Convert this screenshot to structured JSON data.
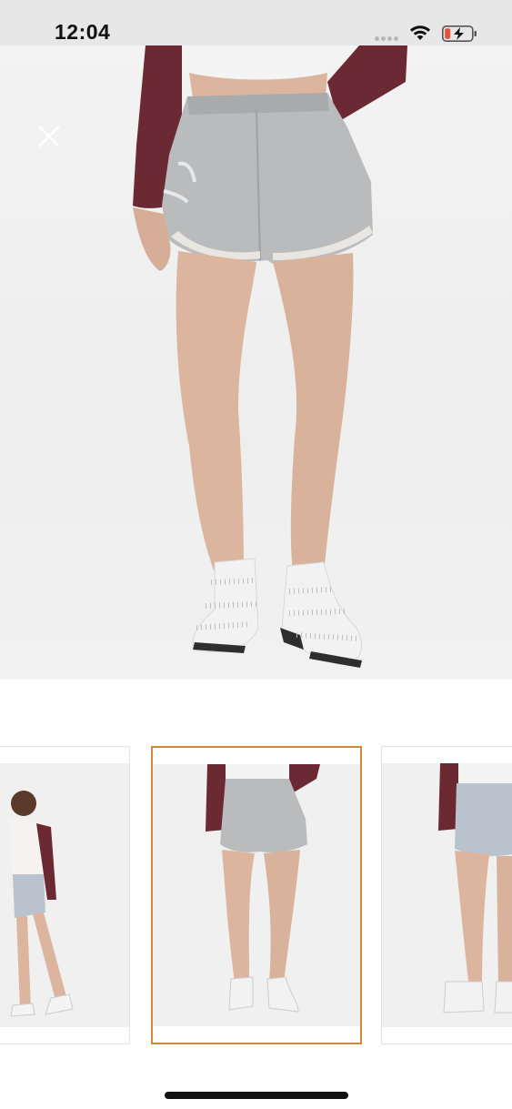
{
  "status_bar": {
    "time": "12:04",
    "icons": [
      "signal-dots-icon",
      "wifi-icon",
      "battery-charging-icon"
    ],
    "battery_color": "#e5533d"
  },
  "hero_image": {
    "alt": "denim-shorts-model-front",
    "close_icon": "close-icon"
  },
  "thumbnails": [
    {
      "name": "thumbnail-side-view",
      "selected": false
    },
    {
      "name": "thumbnail-front-view",
      "selected": true
    },
    {
      "name": "thumbnail-back-view",
      "selected": false
    }
  ],
  "colors": {
    "selected_border": "#d08b3a",
    "denim": "#b9bbbd",
    "top": "#6b2a33",
    "skin": "#dcb59f",
    "boots": "#f2f2f2"
  }
}
